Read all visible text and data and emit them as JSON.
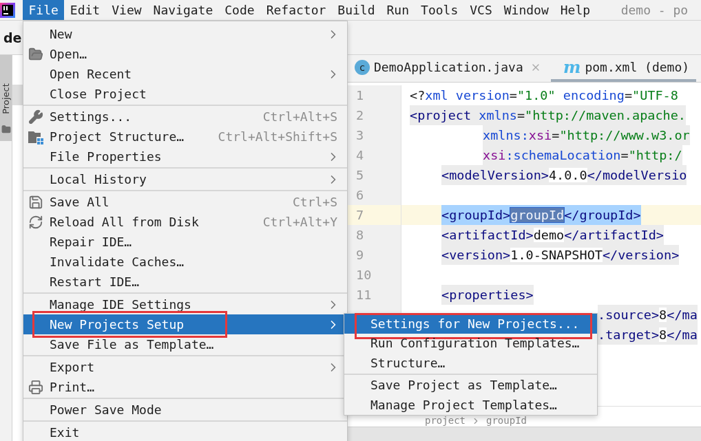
{
  "menubar": {
    "items": [
      {
        "label": "File",
        "selected": true
      },
      {
        "label": "Edit",
        "selected": false
      },
      {
        "label": "View",
        "selected": false
      },
      {
        "label": "Navigate",
        "selected": false
      },
      {
        "label": "Code",
        "selected": false
      },
      {
        "label": "Refactor",
        "selected": false
      },
      {
        "label": "Build",
        "selected": false
      },
      {
        "label": "Run",
        "selected": false
      },
      {
        "label": "Tools",
        "selected": false
      },
      {
        "label": "VCS",
        "selected": false
      },
      {
        "label": "Window",
        "selected": false
      },
      {
        "label": "Help",
        "selected": false
      }
    ],
    "title": "demo - po"
  },
  "navbar": {
    "project": "de"
  },
  "tool_window_tab": {
    "label": "Project",
    "selected": true
  },
  "editor": {
    "tabs": [
      {
        "label": "DemoApplication.java",
        "badge": "c",
        "kind": "java",
        "selected": false,
        "closable": true
      },
      {
        "label": "pom.xml (demo)",
        "badge": "m",
        "kind": "maven",
        "selected": true,
        "closable": false
      }
    ],
    "lines": [
      {
        "number": "1",
        "kind": "root",
        "scoped": false,
        "selected": false,
        "current": false,
        "segments": [
          {
            "kind": "punct",
            "text": "<?"
          },
          {
            "kind": "attr",
            "text": "xml version"
          },
          {
            "kind": "punct",
            "text": "="
          },
          {
            "kind": "value",
            "text": "\"1.0\""
          },
          {
            "kind": "attr",
            "text": " encoding"
          },
          {
            "kind": "punct",
            "text": "="
          },
          {
            "kind": "value",
            "text": "\"UTF-8"
          }
        ]
      },
      {
        "number": "2",
        "kind": "root",
        "scoped": true,
        "selected": false,
        "current": false,
        "segments": [
          {
            "kind": "tag",
            "text": "<project"
          },
          {
            "kind": "attr",
            "text": " xmlns"
          },
          {
            "kind": "punct",
            "text": "="
          },
          {
            "kind": "value",
            "text": "\"http://maven.apache."
          }
        ]
      },
      {
        "number": "3",
        "kind": "attr",
        "scoped": true,
        "selected": false,
        "current": false,
        "segments": [
          {
            "kind": "attr",
            "text": "xmlns:"
          },
          {
            "kind": "ns",
            "text": "xsi"
          },
          {
            "kind": "punct",
            "text": "="
          },
          {
            "kind": "value",
            "text": "\"http://www.w3.or"
          }
        ]
      },
      {
        "number": "4",
        "kind": "attr",
        "scoped": true,
        "selected": false,
        "current": false,
        "segments": [
          {
            "kind": "ns",
            "text": "xsi"
          },
          {
            "kind": "attr",
            "text": ":schemaLocation"
          },
          {
            "kind": "punct",
            "text": "="
          },
          {
            "kind": "value",
            "text": "\"http:/"
          }
        ]
      },
      {
        "number": "5",
        "kind": "child",
        "scoped": true,
        "selected": false,
        "current": false,
        "segments": [
          {
            "kind": "tag",
            "text": "<modelVersion>"
          },
          {
            "kind": "text",
            "text": "4.0.0"
          },
          {
            "kind": "tag",
            "text": "</modelVersio"
          }
        ]
      },
      {
        "number": "6",
        "kind": "child",
        "current": false
      },
      {
        "number": "7",
        "kind": "child",
        "selected": true,
        "current": true,
        "segments": [
          {
            "kind": "tag",
            "text": "<groupId>"
          },
          {
            "kind": "selected",
            "text": "groupId"
          },
          {
            "kind": "tag",
            "text": "</groupId>"
          }
        ]
      },
      {
        "number": "8",
        "kind": "child",
        "scoped": true,
        "selected": false,
        "current": false,
        "segments": [
          {
            "kind": "tag",
            "text": "<artifactId>"
          },
          {
            "kind": "text",
            "text": "demo"
          },
          {
            "kind": "tag",
            "text": "</artifactId>"
          }
        ]
      },
      {
        "number": "9",
        "kind": "child",
        "scoped": true,
        "selected": false,
        "current": false,
        "segments": [
          {
            "kind": "tag",
            "text": "<version>"
          },
          {
            "kind": "text",
            "text": "1.0-SNAPSHOT"
          },
          {
            "kind": "tag",
            "text": "</version>"
          }
        ]
      },
      {
        "number": "10",
        "kind": "child",
        "current": false
      },
      {
        "number": "11",
        "kind": "child",
        "scoped": true,
        "selected": false,
        "current": false,
        "segments": [
          {
            "kind": "tag",
            "text": "<properties>"
          }
        ]
      },
      {
        "kind": "partial",
        "scoped": true,
        "selected": false,
        "current": false,
        "segments": [
          {
            "kind": "tag",
            "text": ".source>"
          },
          {
            "kind": "text",
            "text": "8"
          },
          {
            "kind": "tag",
            "text": "</ma"
          }
        ]
      },
      {
        "kind": "partial",
        "scoped": true,
        "selected": false,
        "current": false,
        "segments": [
          {
            "kind": "tag",
            "text": ".target>"
          },
          {
            "kind": "text",
            "text": "8"
          },
          {
            "kind": "tag",
            "text": "</ma"
          }
        ]
      }
    ],
    "breadcrumbs": [
      "project",
      "groupId"
    ]
  },
  "file_menu": {
    "items": [
      {
        "kind": "item",
        "label": "New",
        "submenu": true,
        "selected": false,
        "annotated": false
      },
      {
        "kind": "item",
        "label": "Open…",
        "submenu": false,
        "selected": false,
        "annotated": false
      },
      {
        "kind": "item",
        "label": "Open Recent",
        "submenu": true,
        "selected": false,
        "annotated": false
      },
      {
        "kind": "item",
        "label": "Close Project",
        "submenu": false,
        "selected": false,
        "annotated": false
      },
      {
        "kind": "separator"
      },
      {
        "kind": "item",
        "label": "Settings...",
        "shortcut": "Ctrl+Alt+S",
        "submenu": false,
        "selected": false,
        "annotated": false
      },
      {
        "kind": "item",
        "label": "Project Structure…",
        "shortcut": "Ctrl+Alt+Shift+S",
        "submenu": false,
        "selected": false,
        "annotated": false
      },
      {
        "kind": "item",
        "label": "File Properties",
        "submenu": true,
        "selected": false,
        "annotated": false
      },
      {
        "kind": "separator"
      },
      {
        "kind": "item",
        "label": "Local History",
        "submenu": true,
        "selected": false,
        "annotated": false
      },
      {
        "kind": "separator"
      },
      {
        "kind": "item",
        "label": "Save All",
        "shortcut": "Ctrl+S",
        "submenu": false,
        "selected": false,
        "annotated": false
      },
      {
        "kind": "item",
        "label": "Reload All from Disk",
        "shortcut": "Ctrl+Alt+Y",
        "submenu": false,
        "selected": false,
        "annotated": false
      },
      {
        "kind": "item",
        "label": "Repair IDE…",
        "submenu": false,
        "selected": false,
        "annotated": false
      },
      {
        "kind": "item",
        "label": "Invalidate Caches…",
        "submenu": false,
        "selected": false,
        "annotated": false
      },
      {
        "kind": "item",
        "label": "Restart IDE…",
        "submenu": false,
        "selected": false,
        "annotated": false
      },
      {
        "kind": "separator"
      },
      {
        "kind": "item",
        "label": "Manage IDE Settings",
        "submenu": true,
        "selected": false,
        "annotated": false
      },
      {
        "kind": "item",
        "label": "New Projects Setup",
        "submenu": true,
        "selected": true,
        "annotated": true
      },
      {
        "kind": "item",
        "label": "Save File as Template…",
        "submenu": false,
        "selected": false,
        "annotated": false
      },
      {
        "kind": "separator"
      },
      {
        "kind": "item",
        "label": "Export",
        "submenu": true,
        "selected": false,
        "annotated": false
      },
      {
        "kind": "item",
        "label": "Print…",
        "submenu": false,
        "selected": false,
        "annotated": false
      },
      {
        "kind": "separator"
      },
      {
        "kind": "item",
        "label": "Power Save Mode",
        "submenu": false,
        "selected": false,
        "annotated": false
      },
      {
        "kind": "separator"
      },
      {
        "kind": "item",
        "label": "Exit",
        "submenu": false,
        "selected": false,
        "annotated": false
      }
    ]
  },
  "submenu": {
    "items": [
      {
        "kind": "item",
        "label": "Settings for New Projects...",
        "selected": true,
        "annotated": true
      },
      {
        "kind": "item",
        "label": "Run Configuration Templates…",
        "selected": false,
        "annotated": false
      },
      {
        "kind": "item",
        "label": "Structure…",
        "selected": false,
        "annotated": false
      },
      {
        "kind": "separator"
      },
      {
        "kind": "item",
        "label": "Save Project as Template…",
        "selected": false,
        "annotated": false
      },
      {
        "kind": "item",
        "label": "Manage Project Templates…",
        "selected": false,
        "annotated": false
      }
    ]
  }
}
